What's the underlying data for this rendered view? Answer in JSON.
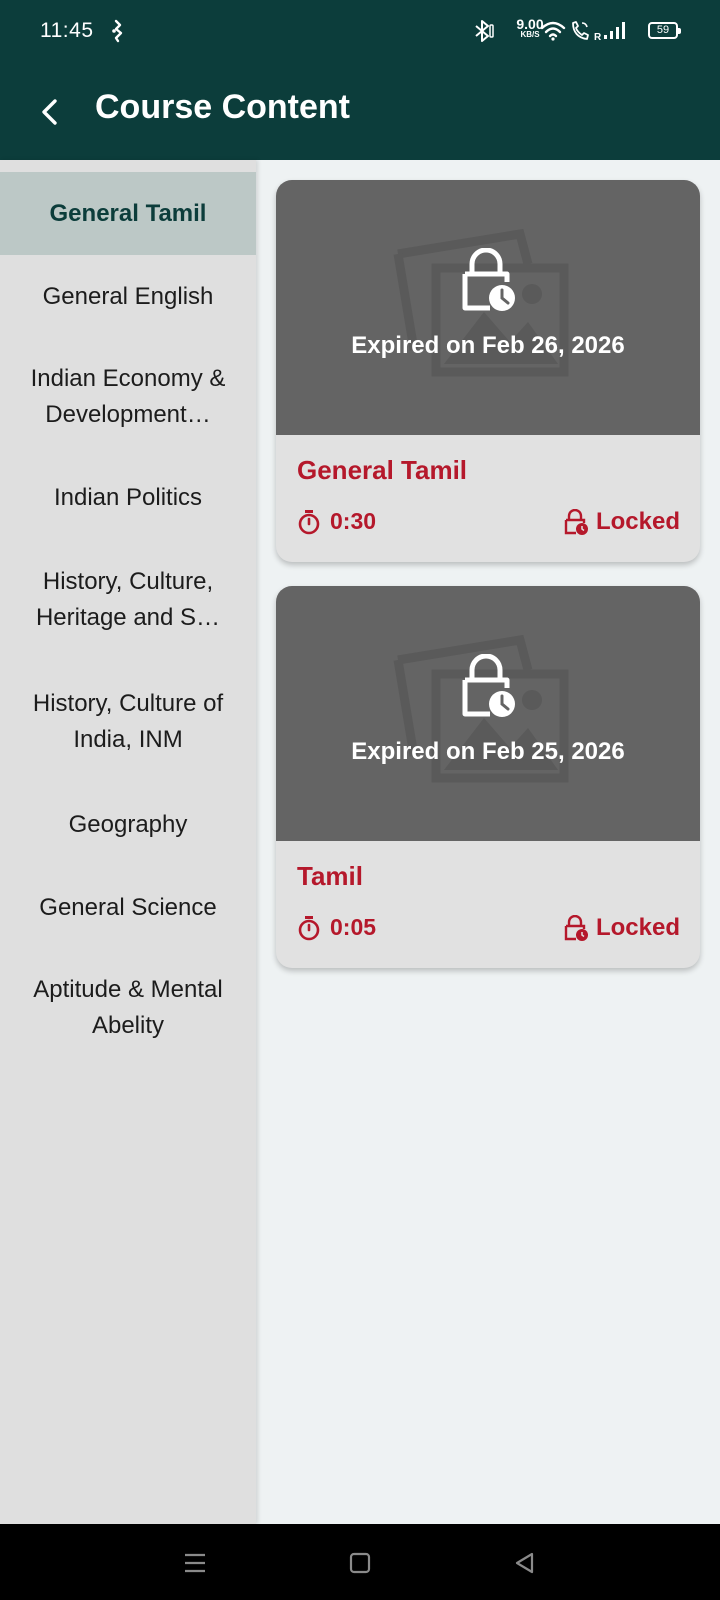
{
  "status_bar": {
    "time": "11:45",
    "network_speed": "9.00",
    "network_speed_unit": "KB/S",
    "roaming_indicator": "R",
    "battery_level": "59"
  },
  "app_bar": {
    "title": "Course Content",
    "back_icon": "arrow-back-icon"
  },
  "sidebar": {
    "items": [
      {
        "label": "General Tamil",
        "active": true
      },
      {
        "label": "General English"
      },
      {
        "label": "Indian Economy & Development…"
      },
      {
        "label": "Indian Politics"
      },
      {
        "label": "History, Culture, Heritage and S…"
      },
      {
        "label": "History, Culture of India, INM"
      },
      {
        "label": "Geography"
      },
      {
        "label": "General Science"
      },
      {
        "label": "Aptitude & Mental Abelity"
      }
    ]
  },
  "courses": [
    {
      "expired_text": "Expired on Feb 26, 2026",
      "name": "General Tamil",
      "duration": "0:30",
      "status": "Locked"
    },
    {
      "expired_text": "Expired on Feb 25, 2026",
      "name": "Tamil",
      "duration": "0:05",
      "status": "Locked"
    }
  ],
  "colors": {
    "primary": "#0c3d3b",
    "accent_red": "#b5182b",
    "sidebar_bg": "#dfdfdf",
    "sidebar_active_bg": "#bcc8c6",
    "thumbnail_bg": "#646464",
    "content_bg": "#eef2f3"
  }
}
